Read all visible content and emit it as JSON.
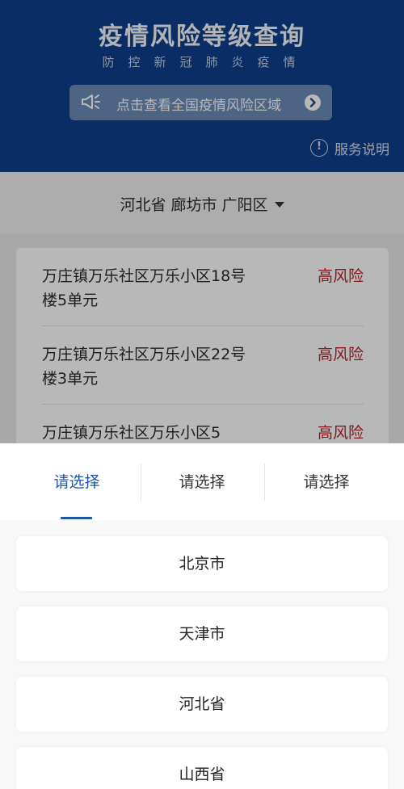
{
  "header": {
    "title": "疫情风险等级查询",
    "subtitle": "防控新冠肺炎疫情",
    "risk_area_button": "点击查看全国疫情风险区域",
    "service_note": "服务说明",
    "info_icon_text": "!"
  },
  "region": {
    "label": "河北省 廊坊市 广阳区"
  },
  "risk_list": [
    {
      "address": "万庄镇万乐社区万乐小区18号楼5单元",
      "level": "高风险"
    },
    {
      "address": "万庄镇万乐社区万乐小区22号楼3单元",
      "level": "高风险"
    },
    {
      "address": "万庄镇万乐社区万乐小区5",
      "level": "高风险"
    }
  ],
  "picker": {
    "tabs": [
      "请选择",
      "请选择",
      "请选择"
    ],
    "active_tab": 0,
    "provinces": [
      "北京市",
      "天津市",
      "河北省",
      "山西省"
    ]
  },
  "colors": {
    "header_bg": "#0f3f8c",
    "accent": "#1b57a3",
    "high_risk": "#b8202a"
  },
  "icons": {
    "megaphone": "megaphone-icon",
    "arrow": "arrow-right-circle-icon",
    "info": "info-icon",
    "caret": "caret-down-icon"
  }
}
